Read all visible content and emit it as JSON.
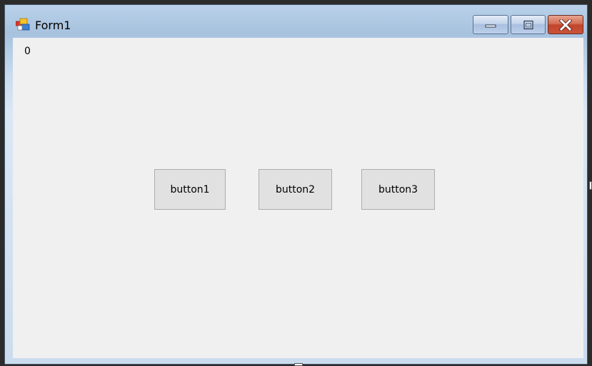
{
  "window": {
    "title": "Form1",
    "icon": "winforms-app-icon"
  },
  "caption_buttons": {
    "minimize_icon": "minimize-icon",
    "maximize_icon": "maximize-icon",
    "close_icon": "close-icon"
  },
  "client": {
    "label": "0",
    "buttons": [
      {
        "label": "button1"
      },
      {
        "label": "button2"
      },
      {
        "label": "button3"
      }
    ]
  },
  "colors": {
    "client_background": "#f0f0f0",
    "button_face": "#e1e1e1",
    "button_border": "#adadad",
    "titlebar": "#b9d1ea",
    "close_button": "#c1432a"
  }
}
